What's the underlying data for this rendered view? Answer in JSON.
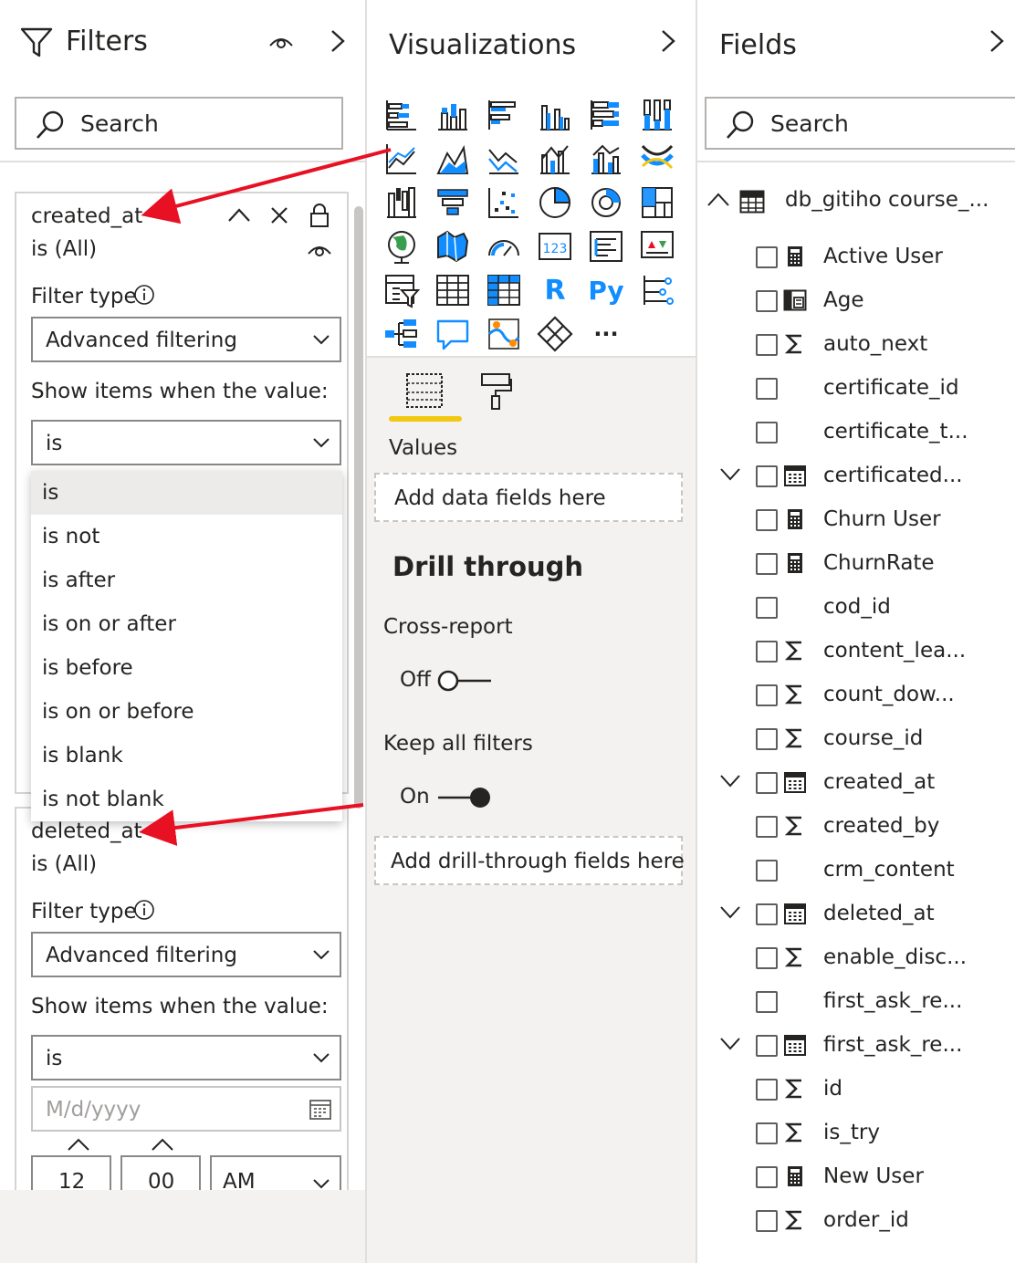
{
  "filters": {
    "title": "Filters",
    "search_placeholder": "Search",
    "cards": [
      {
        "field": "created_at",
        "summary": "is (All)",
        "filter_type_label": "Filter type",
        "filter_type_value": "Advanced filtering",
        "show_items_label": "Show items when the value:",
        "condition_value": "is"
      },
      {
        "field": "deleted_at",
        "summary": "is (All)",
        "filter_type_label": "Filter type",
        "filter_type_value": "Advanced filtering",
        "show_items_label": "Show items when the value:",
        "condition_value": "is",
        "date_placeholder": "M/d/yyyy",
        "hour": "12",
        "minute": "00",
        "ampm": "AM"
      }
    ],
    "condition_options": [
      "is",
      "is not",
      "is after",
      "is on or after",
      "is before",
      "is on or before",
      "is blank",
      "is not blank"
    ],
    "selected_option": "is"
  },
  "visualizations": {
    "title": "Visualizations",
    "icons": [
      "stacked-bar-chart-icon",
      "stacked-column-chart-icon",
      "clustered-bar-chart-icon",
      "clustered-column-chart-icon",
      "100-stacked-bar-chart-icon",
      "100-stacked-column-chart-icon",
      "line-chart-icon",
      "area-chart-icon",
      "stacked-area-chart-icon",
      "line-and-stacked-column-icon",
      "line-and-clustered-column-icon",
      "ribbon-chart-icon",
      "waterfall-chart-icon",
      "funnel-icon",
      "scatter-chart-icon",
      "pie-chart-icon",
      "donut-chart-icon",
      "treemap-icon",
      "map-icon",
      "filled-map-icon",
      "gauge-icon",
      "card-icon",
      "multi-row-card-icon",
      "kpi-icon",
      "slicer-icon",
      "table-icon",
      "matrix-icon",
      "r-script-icon",
      "python-script-icon",
      "key-influencers-icon",
      "decomposition-tree-icon",
      "qa-icon",
      "arcgis-map-icon",
      "power-apps-icon",
      "more-visuals-icon"
    ],
    "r_label": "R",
    "py_label": "Py",
    "more_label": "···",
    "values_label": "Values",
    "add_data_fields": "Add data fields here",
    "drill_through_title": "Drill through",
    "cross_report_label": "Cross-report",
    "cross_report_state": "Off",
    "keep_all_filters_label": "Keep all filters",
    "keep_all_filters_state": "On",
    "add_drill_through": "Add drill-through fields here"
  },
  "fields": {
    "title": "Fields",
    "search_placeholder": "Search",
    "table_name": "db_gitiho course_...",
    "items": [
      {
        "name": "Active User",
        "icon": "calculator-icon",
        "expand": false
      },
      {
        "name": "Age",
        "icon": "calculated-column-icon",
        "expand": false
      },
      {
        "name": "auto_next",
        "icon": "sigma-icon",
        "expand": false
      },
      {
        "name": "certificate_id",
        "icon": "",
        "expand": false
      },
      {
        "name": "certificate_t...",
        "icon": "",
        "expand": false
      },
      {
        "name": "certificated...",
        "icon": "calendar-icon",
        "expand": true
      },
      {
        "name": "Churn User",
        "icon": "calculator-icon",
        "expand": false
      },
      {
        "name": "ChurnRate",
        "icon": "calculator-icon",
        "expand": false
      },
      {
        "name": "cod_id",
        "icon": "",
        "expand": false
      },
      {
        "name": "content_lea...",
        "icon": "sigma-icon",
        "expand": false
      },
      {
        "name": "count_dow...",
        "icon": "sigma-icon",
        "expand": false
      },
      {
        "name": "course_id",
        "icon": "sigma-icon",
        "expand": false
      },
      {
        "name": "created_at",
        "icon": "calendar-icon",
        "expand": true
      },
      {
        "name": "created_by",
        "icon": "sigma-icon",
        "expand": false
      },
      {
        "name": "crm_content",
        "icon": "",
        "expand": false
      },
      {
        "name": "deleted_at",
        "icon": "calendar-icon",
        "expand": true
      },
      {
        "name": "enable_disc...",
        "icon": "sigma-icon",
        "expand": false
      },
      {
        "name": "first_ask_re...",
        "icon": "",
        "expand": false
      },
      {
        "name": "first_ask_re...",
        "icon": "calendar-icon",
        "expand": true
      },
      {
        "name": "id",
        "icon": "sigma-icon",
        "expand": false
      },
      {
        "name": "is_try",
        "icon": "sigma-icon",
        "expand": false
      },
      {
        "name": "New User",
        "icon": "calculator-icon",
        "expand": false
      },
      {
        "name": "order_id",
        "icon": "sigma-icon",
        "expand": false
      }
    ]
  },
  "colors": {
    "accent_yellow": "#f2c811",
    "arrow_red": "#e81123",
    "viz_blue": "#118dff",
    "viz_dark": "#252423"
  }
}
